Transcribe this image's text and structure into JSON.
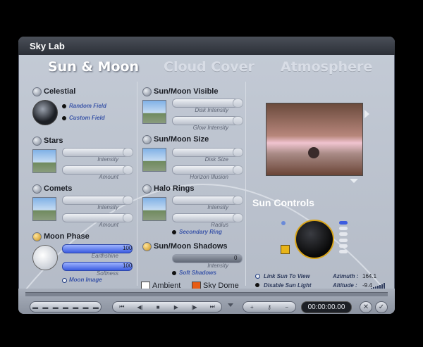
{
  "window": {
    "title": "Sky Lab"
  },
  "tabs": [
    {
      "label": "Sun & Moon"
    },
    {
      "label": "Cloud Cover"
    },
    {
      "label": "Atmosphere"
    }
  ],
  "celestial": {
    "title": "Celestial",
    "options": [
      "Random Field",
      "Custom Field"
    ]
  },
  "stars": {
    "title": "Stars",
    "sliders": [
      "Intensity",
      "Amount"
    ]
  },
  "comets": {
    "title": "Comets",
    "sliders": [
      "Intensity",
      "Amount"
    ]
  },
  "moon_phase": {
    "title": "Moon Phase",
    "sliders": [
      {
        "label": "Earthshine",
        "value": "100"
      },
      {
        "label": "Softness",
        "value": "100"
      }
    ],
    "option": "Moon Image"
  },
  "sunmoon_visible": {
    "title": "Sun/Moon Visible",
    "sliders": [
      "Disk Intensity",
      "Glow Intensity"
    ]
  },
  "sunmoon_size": {
    "title": "Sun/Moon Size",
    "sliders": [
      "Disk Size",
      "Horizon Illusion"
    ]
  },
  "halo_rings": {
    "title": "Halo Rings",
    "sliders": [
      "Intensity",
      "Radius"
    ],
    "option": "Secondary Ring"
  },
  "shadows": {
    "title": "Sun/Moon Shadows",
    "slider": {
      "label": "Intensity",
      "value": "0"
    },
    "option": "Soft Shadows"
  },
  "colors": {
    "ambient_label": "Ambient",
    "ambient_color": "#ffffff",
    "skydome_label": "Sky Dome",
    "skydome_color": "#e85c14"
  },
  "sun_controls": {
    "title": "Sun Controls",
    "link_label": "Link Sun To View",
    "disable_label": "Disable Sun Light",
    "azimuth_label": "Azimuth :",
    "azimuth_value": "164.1",
    "altitude_label": "Altitude :",
    "altitude_value": "-9.4"
  },
  "timeline": {
    "timecode": "00:00:00.00"
  }
}
